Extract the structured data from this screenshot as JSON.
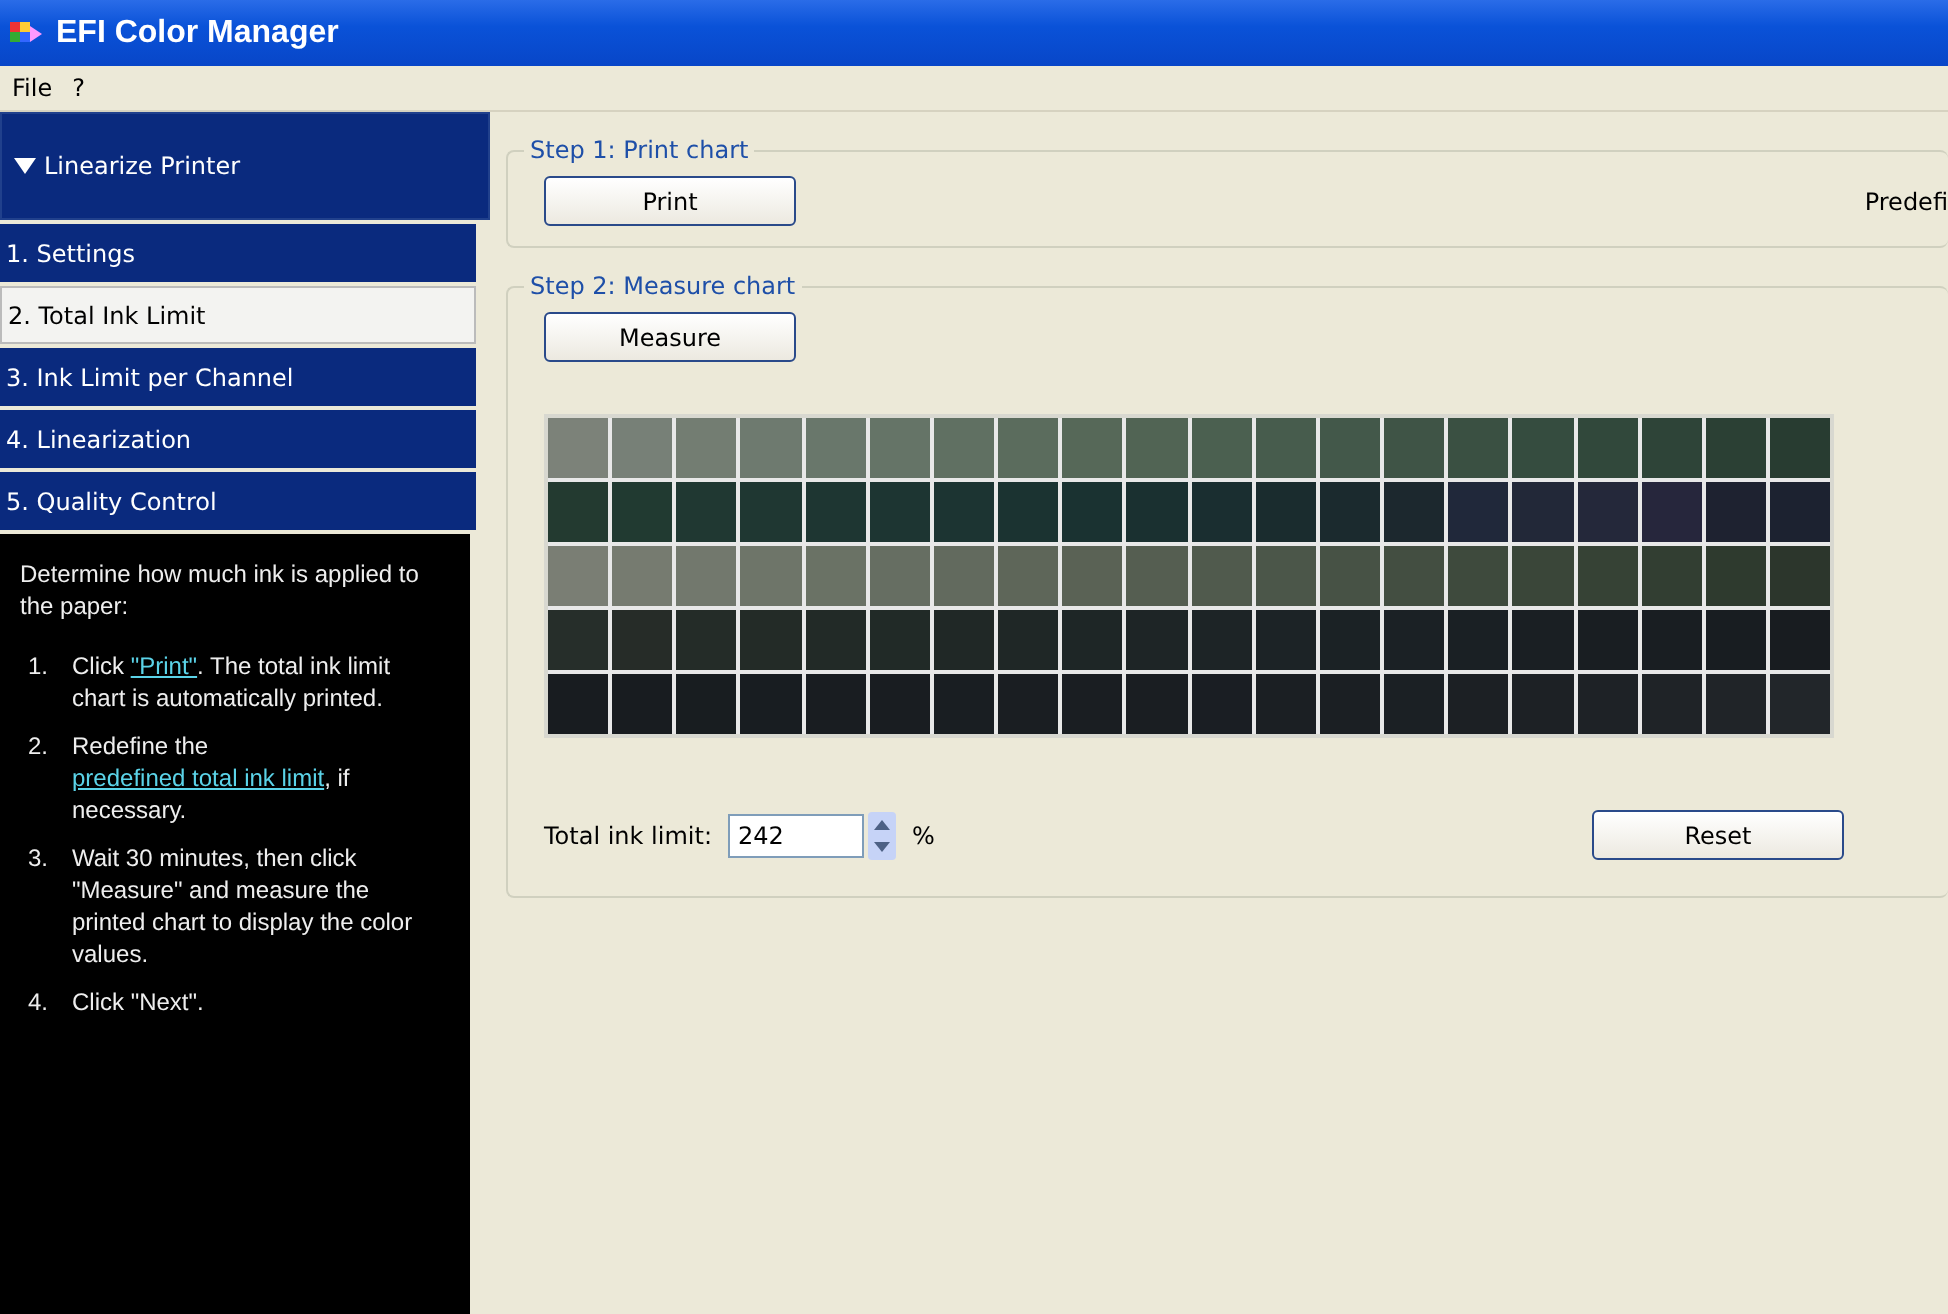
{
  "window": {
    "title": "EFI Color Manager"
  },
  "menu": [
    "File",
    "?"
  ],
  "sidebar": {
    "header": {
      "label": "Linearize Printer",
      "expanded": true
    },
    "items": [
      {
        "label": "1. Settings",
        "selected": false
      },
      {
        "label": "2. Total Ink Limit",
        "selected": true
      },
      {
        "label": "3. Ink Limit per Channel",
        "selected": false
      },
      {
        "label": "4. Linearization",
        "selected": false
      },
      {
        "label": "5. Quality Control",
        "selected": false
      }
    ]
  },
  "help": {
    "intro": "Determine how much ink is applied to the paper:",
    "steps": [
      {
        "number": "1.",
        "parts": [
          {
            "kind": "text",
            "text": "Click "
          },
          {
            "kind": "link",
            "text": "\"Print\""
          },
          {
            "kind": "text",
            "text": ". The total ink limit chart is automatically printed."
          }
        ]
      },
      {
        "number": "2.",
        "parts": [
          {
            "kind": "text",
            "text": "Redefine the "
          },
          {
            "kind": "link",
            "text": "predefined total ink limit"
          },
          {
            "kind": "text",
            "text": ", if necessary."
          }
        ]
      },
      {
        "number": "3.",
        "parts": [
          {
            "kind": "text",
            "text": "Wait 30 minutes, then click \"Measure\" and measure the printed chart to display the color values."
          }
        ]
      },
      {
        "number": "4.",
        "parts": [
          {
            "kind": "text",
            "text": "Click \"Next\"."
          }
        ]
      }
    ]
  },
  "step1": {
    "title": "Step 1: Print chart",
    "button": "Print",
    "side_label": "Predefi"
  },
  "step2": {
    "title": "Step 2: Measure chart",
    "button": "Measure",
    "patch_rows": [
      {
        "patches": [
          {
            "color": "#7c8279"
          },
          {
            "color": "#778077"
          },
          {
            "color": "#737d72"
          },
          {
            "color": "#6e7a6f"
          },
          {
            "color": "#69776b"
          },
          {
            "color": "#657467"
          },
          {
            "color": "#607062"
          },
          {
            "color": "#5b6c5d"
          },
          {
            "color": "#566858"
          },
          {
            "color": "#516454"
          },
          {
            "color": "#4b6050"
          },
          {
            "color": "#475c4d"
          },
          {
            "color": "#43584a"
          },
          {
            "color": "#3f5446"
          },
          {
            "color": "#3a5042"
          },
          {
            "color": "#354c3f"
          },
          {
            "color": "#31483b"
          },
          {
            "color": "#2e4438"
          },
          {
            "color": "#2b4034"
          },
          {
            "color": "#283c31"
          }
        ]
      },
      {
        "patches": [
          {
            "color": "#233a30"
          },
          {
            "color": "#213a31"
          },
          {
            "color": "#203832"
          },
          {
            "color": "#1f3732"
          },
          {
            "color": "#1e3632"
          },
          {
            "color": "#1d3532"
          },
          {
            "color": "#1c3432"
          },
          {
            "color": "#1b3331"
          },
          {
            "color": "#1a3231"
          },
          {
            "color": "#1a3030"
          },
          {
            "color": "#1a2e30"
          },
          {
            "color": "#1a2c2e"
          },
          {
            "color": "#1b2a2e"
          },
          {
            "color": "#1c282e"
          },
          {
            "color": "#20283a"
          },
          {
            "color": "#222838"
          },
          {
            "color": "#24283a"
          },
          {
            "color": "#26263c"
          },
          {
            "color": "#1e2230"
          },
          {
            "color": "#1c2230"
          }
        ]
      },
      {
        "patches": [
          {
            "color": "#7a7e74"
          },
          {
            "color": "#767b70"
          },
          {
            "color": "#72786d"
          },
          {
            "color": "#6e7569"
          },
          {
            "color": "#6a7265"
          },
          {
            "color": "#666e62"
          },
          {
            "color": "#626a5e"
          },
          {
            "color": "#5e6659"
          },
          {
            "color": "#5a6255"
          },
          {
            "color": "#555e51"
          },
          {
            "color": "#505a4d"
          },
          {
            "color": "#4b5649"
          },
          {
            "color": "#475245"
          },
          {
            "color": "#434e41"
          },
          {
            "color": "#3e4a3d"
          },
          {
            "color": "#3a4639"
          },
          {
            "color": "#364235"
          },
          {
            "color": "#323e32"
          },
          {
            "color": "#2e3a2e"
          },
          {
            "color": "#2c362c"
          }
        ]
      },
      {
        "patches": [
          {
            "color": "#262e2a"
          },
          {
            "color": "#262c28"
          },
          {
            "color": "#242c28"
          },
          {
            "color": "#232b27"
          },
          {
            "color": "#222a27"
          },
          {
            "color": "#212a27"
          },
          {
            "color": "#202826"
          },
          {
            "color": "#1f2726"
          },
          {
            "color": "#1e2626"
          },
          {
            "color": "#1e2526"
          },
          {
            "color": "#1d2426"
          },
          {
            "color": "#1c2326"
          },
          {
            "color": "#1b2225"
          },
          {
            "color": "#1b2125"
          },
          {
            "color": "#1a2024"
          },
          {
            "color": "#1a1f23"
          },
          {
            "color": "#191e22"
          },
          {
            "color": "#191e22"
          },
          {
            "color": "#181d21"
          },
          {
            "color": "#181c20"
          }
        ]
      },
      {
        "patches": [
          {
            "color": "#181c20"
          },
          {
            "color": "#181c20"
          },
          {
            "color": "#181d20"
          },
          {
            "color": "#181d21"
          },
          {
            "color": "#191d21"
          },
          {
            "color": "#191d21"
          },
          {
            "color": "#191e22"
          },
          {
            "color": "#1a1e22"
          },
          {
            "color": "#1a1e22"
          },
          {
            "color": "#1a1e22"
          },
          {
            "color": "#1a1e23"
          },
          {
            "color": "#1b1f23"
          },
          {
            "color": "#1b1f23"
          },
          {
            "color": "#1b2024"
          },
          {
            "color": "#1c2024"
          },
          {
            "color": "#1d2125"
          },
          {
            "color": "#1e2226"
          },
          {
            "color": "#1f2327"
          },
          {
            "color": "#202428"
          },
          {
            "color": "#22262a"
          }
        ]
      }
    ],
    "limit_label": "Total ink limit:",
    "limit_value": "242",
    "unit": "%",
    "reset": "Reset"
  }
}
